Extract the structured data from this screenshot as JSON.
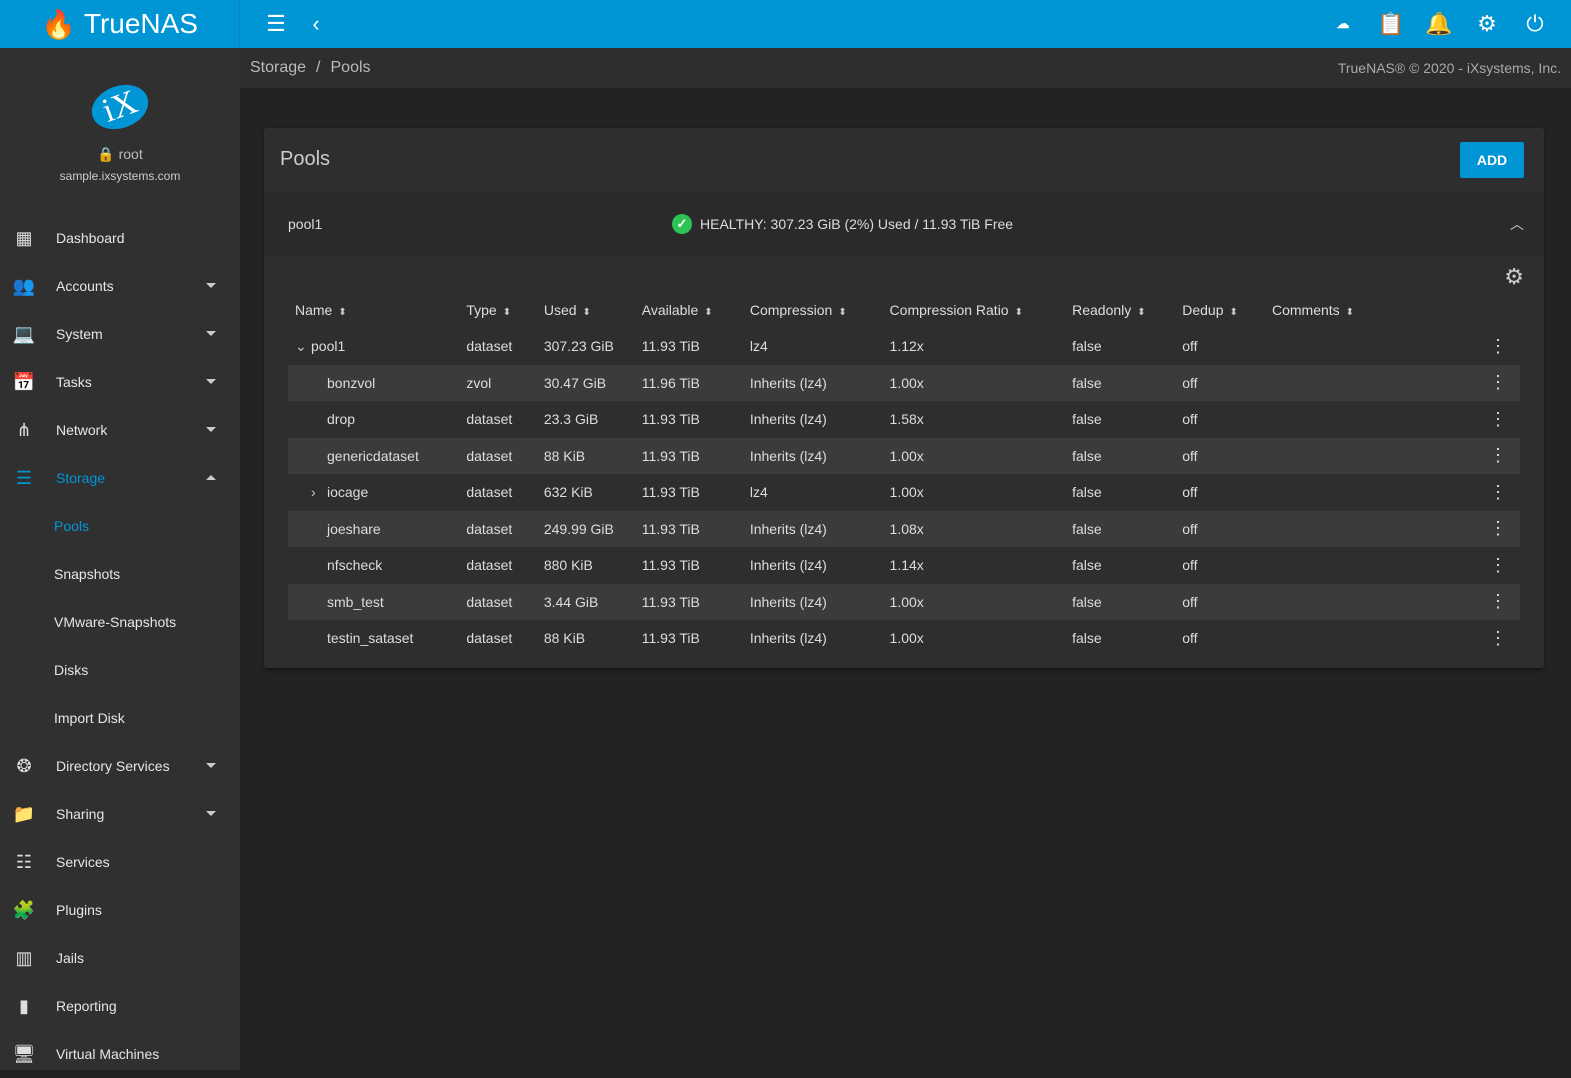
{
  "header": {
    "brand": "TrueNAS",
    "icons": [
      "ha-cloud-icon",
      "clipboard-icon",
      "bell-icon",
      "gear-icon",
      "power-icon"
    ]
  },
  "profile": {
    "user": "root",
    "host": "sample.ixsystems.com",
    "logo": "iX"
  },
  "sidebar": {
    "items": [
      {
        "label": "Dashboard",
        "icon": "dashboard-icon"
      },
      {
        "label": "Accounts",
        "icon": "people-icon"
      },
      {
        "label": "System",
        "icon": "laptop-icon"
      },
      {
        "label": "Tasks",
        "icon": "calendar-icon"
      },
      {
        "label": "Network",
        "icon": "network-icon"
      },
      {
        "label": "Storage",
        "icon": "storage-icon"
      },
      {
        "label": "Pools"
      },
      {
        "label": "Snapshots"
      },
      {
        "label": "VMware-Snapshots"
      },
      {
        "label": "Disks"
      },
      {
        "label": "Import Disk"
      },
      {
        "label": "Directory Services",
        "icon": "directory-icon"
      },
      {
        "label": "Sharing",
        "icon": "folder-shared-icon"
      },
      {
        "label": "Services",
        "icon": "tune-icon"
      },
      {
        "label": "Plugins",
        "icon": "puzzle-icon"
      },
      {
        "label": "Jails",
        "icon": "jail-icon"
      },
      {
        "label": "Reporting",
        "icon": "chart-icon"
      },
      {
        "label": "Virtual Machines",
        "icon": "computer-icon"
      }
    ]
  },
  "breadcrumb": {
    "parent": "Storage",
    "sep": "/",
    "current": "Pools"
  },
  "copyright": "TrueNAS® © 2020 - iXsystems, Inc.",
  "card": {
    "title": "Pools",
    "add_label": "ADD"
  },
  "pool": {
    "name": "pool1",
    "status": "HEALTHY: 307.23 GiB (2%) Used / 11.93 TiB Free",
    "status_color": "#2ec455"
  },
  "table": {
    "columns": [
      "Name",
      "Type",
      "Used",
      "Available",
      "Compression",
      "Compression Ratio",
      "Readonly",
      "Dedup",
      "Comments"
    ],
    "rows": [
      [
        "pool1",
        "dataset",
        "307.23 GiB",
        "11.93 TiB",
        "lz4",
        "1.12x",
        "false",
        "off",
        ""
      ],
      [
        "bonzvol",
        "zvol",
        "30.47 GiB",
        "11.96 TiB",
        "Inherits (lz4)",
        "1.00x",
        "false",
        "off",
        ""
      ],
      [
        "drop",
        "dataset",
        "23.3 GiB",
        "11.93 TiB",
        "Inherits (lz4)",
        "1.58x",
        "false",
        "off",
        ""
      ],
      [
        "genericdataset",
        "dataset",
        "88 KiB",
        "11.93 TiB",
        "Inherits (lz4)",
        "1.00x",
        "false",
        "off",
        ""
      ],
      [
        "iocage",
        "dataset",
        "632 KiB",
        "11.93 TiB",
        "lz4",
        "1.00x",
        "false",
        "off",
        ""
      ],
      [
        "joeshare",
        "dataset",
        "249.99 GiB",
        "11.93 TiB",
        "Inherits (lz4)",
        "1.08x",
        "false",
        "off",
        ""
      ],
      [
        "nfscheck",
        "dataset",
        "880 KiB",
        "11.93 TiB",
        "Inherits (lz4)",
        "1.14x",
        "false",
        "off",
        ""
      ],
      [
        "smb_test",
        "dataset",
        "3.44 GiB",
        "11.93 TiB",
        "Inherits (lz4)",
        "1.00x",
        "false",
        "off",
        ""
      ],
      [
        "testin_sataset",
        "dataset",
        "88 KiB",
        "11.93 TiB",
        "Inherits (lz4)",
        "1.00x",
        "false",
        "off",
        ""
      ]
    ]
  }
}
